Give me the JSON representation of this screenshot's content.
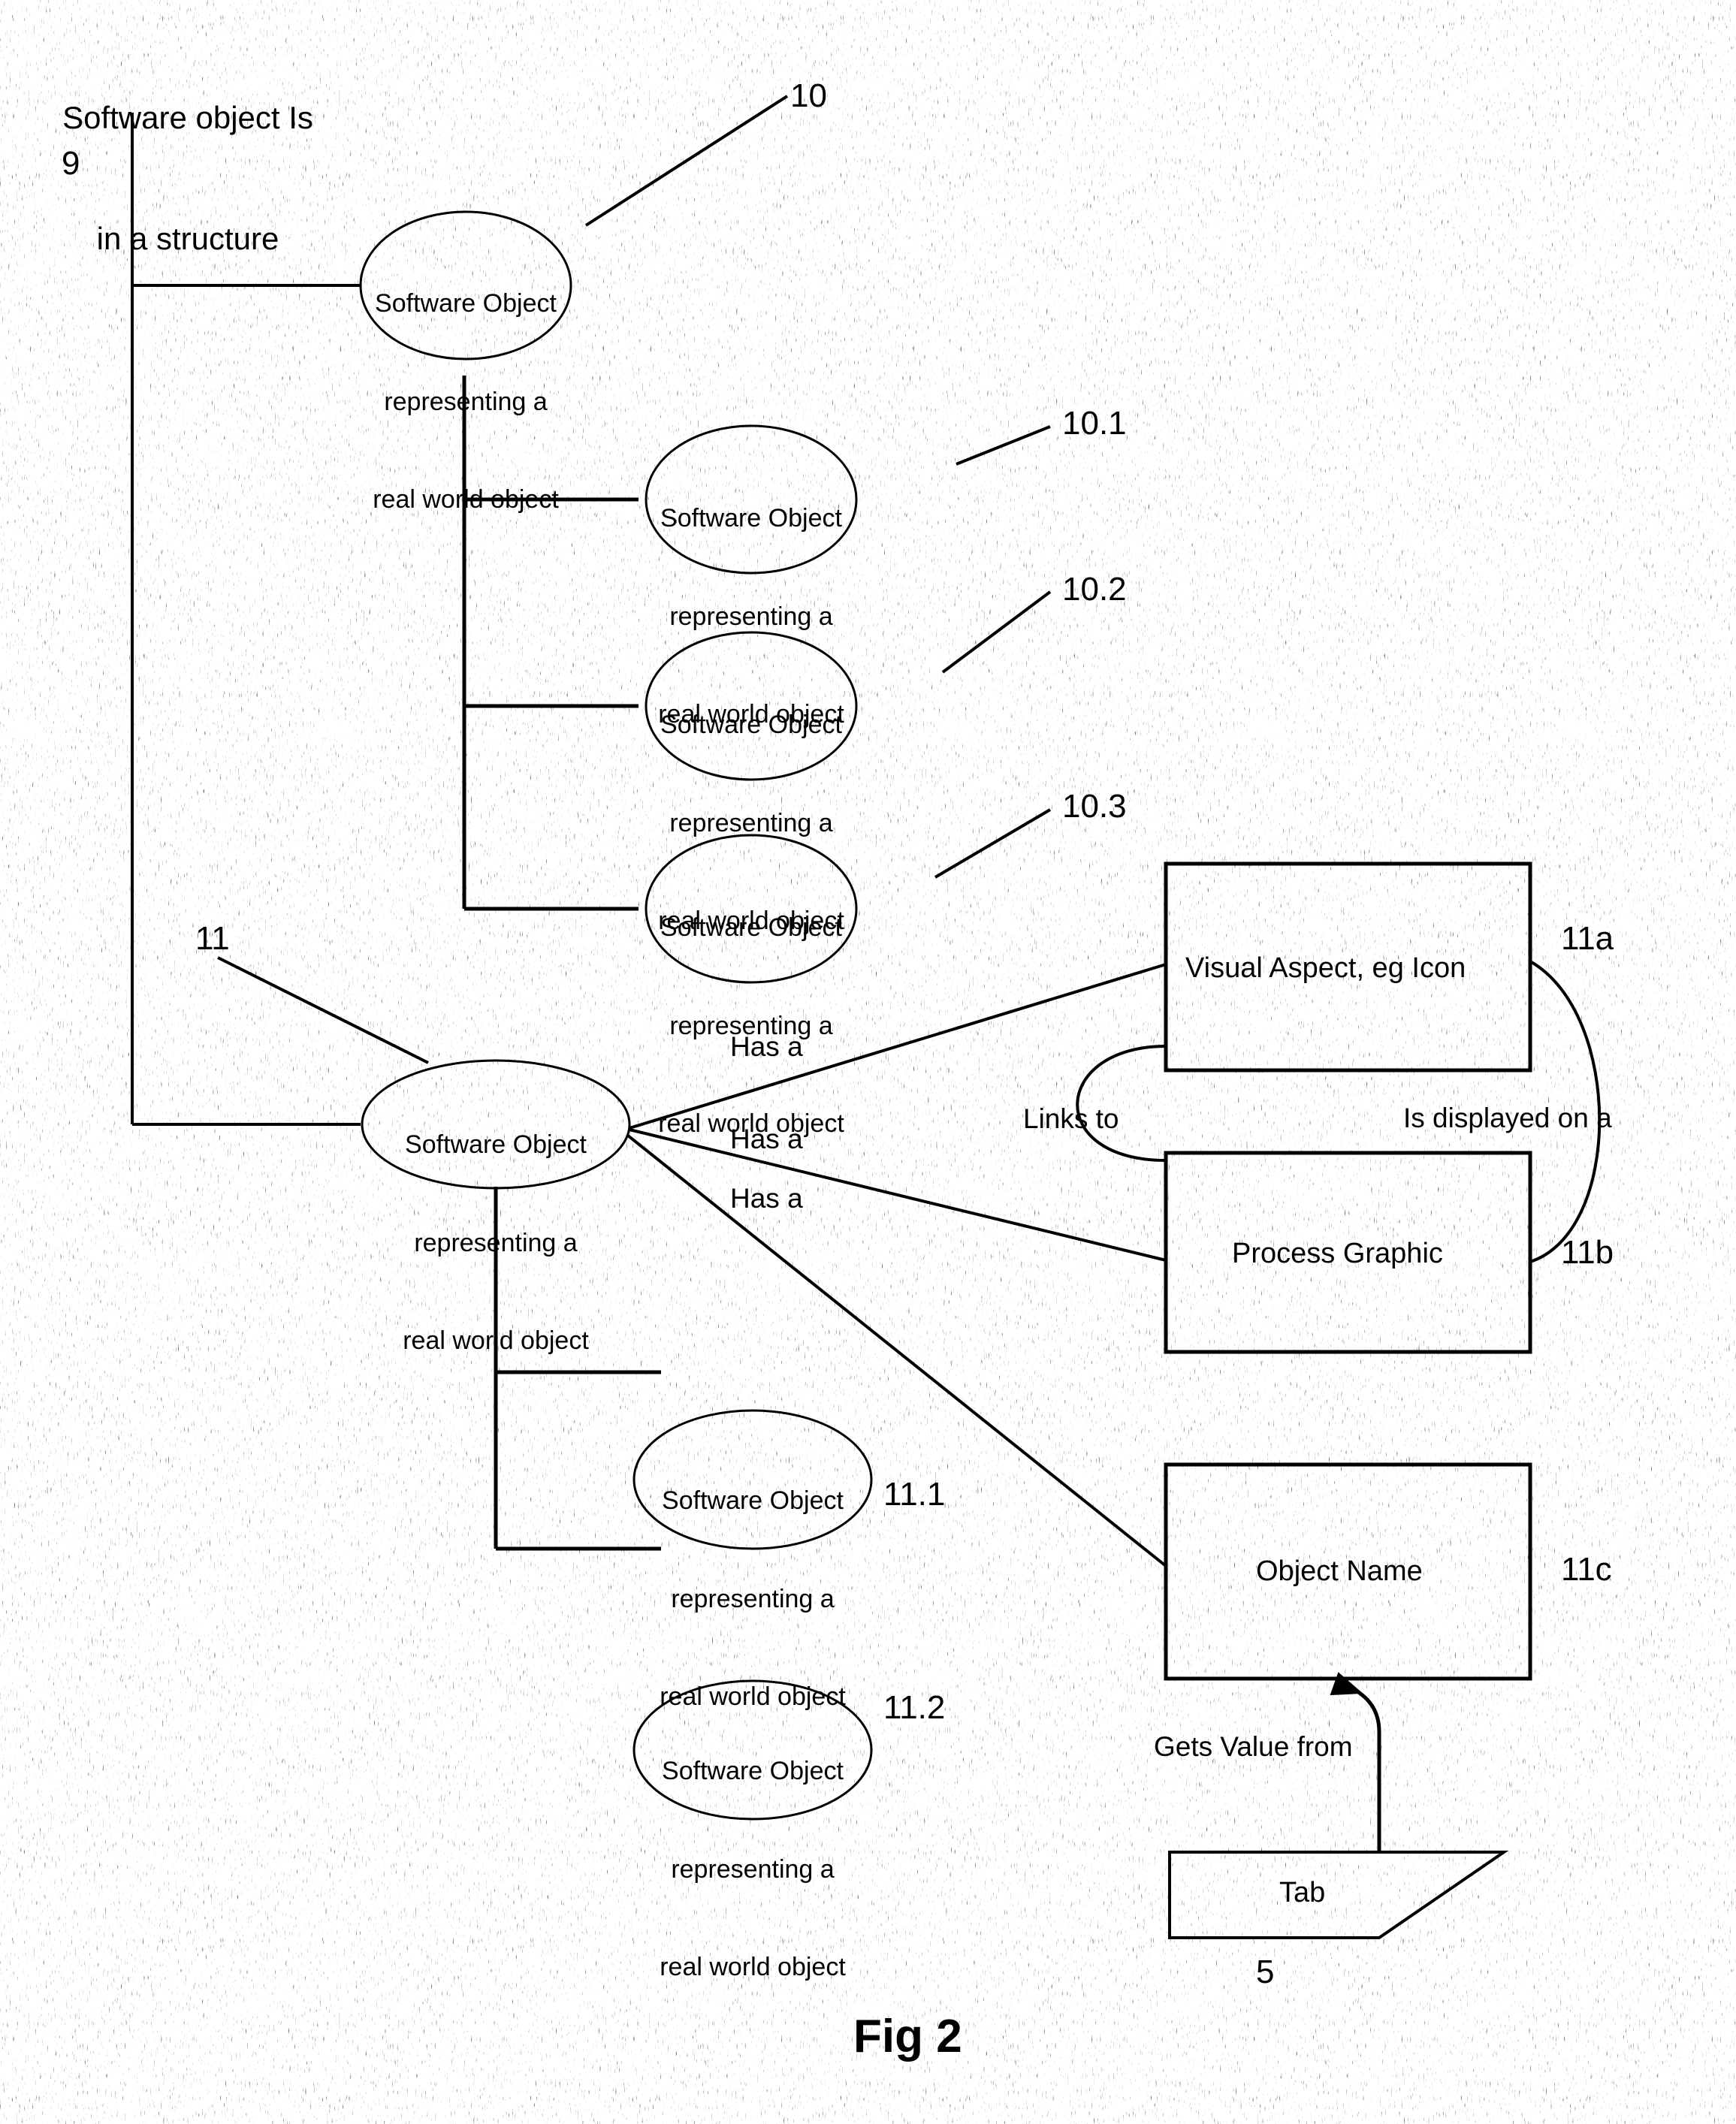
{
  "figure": {
    "caption": "Fig 2",
    "title_line1": "Software object Is",
    "title_line2": "in a structure",
    "structure_ref": "9"
  },
  "nodes": {
    "root": {
      "line1": "Software Object",
      "line2": "representing a",
      "line3": "real world object",
      "ref": "10"
    },
    "child_10_1": {
      "line1": "Software Object",
      "line2": "representing a",
      "line3": "real world object",
      "ref": "10.1"
    },
    "child_10_2": {
      "line1": "Software Object",
      "line2": "representing a",
      "line3": "real world object",
      "ref": "10.2"
    },
    "child_10_3": {
      "line1": "Software Object",
      "line2": "representing a",
      "line3": "real world object",
      "ref": "10.3"
    },
    "second_root": {
      "line1": "Software Object",
      "line2": "representing a",
      "line3": "real world object",
      "ref": "11"
    },
    "child_11_1": {
      "line1": "Software Object",
      "line2": "representing a",
      "line3": "real world object",
      "ref": "11.1"
    },
    "child_11_2": {
      "line1": "Software Object",
      "line2": "representing a",
      "line3": "real world object",
      "ref": "11.2"
    }
  },
  "boxes": {
    "visual_aspect": {
      "label": "Visual Aspect, eg Icon",
      "ref": "11a"
    },
    "process_graphic": {
      "label": "Process Graphic",
      "ref": "11b"
    },
    "object_name": {
      "label": "Object Name",
      "ref": "11c"
    },
    "tab": {
      "label": "Tab",
      "ref": "5"
    }
  },
  "edges": {
    "has_a_1": "Has a",
    "has_a_2": "Has a",
    "has_a_3": "Has a",
    "links_to": "Links to",
    "is_displayed_on_a": "Is displayed on a",
    "gets_value_from": "Gets Value from"
  },
  "colors": {
    "ink": "#000000",
    "paper": "#ffffff"
  }
}
